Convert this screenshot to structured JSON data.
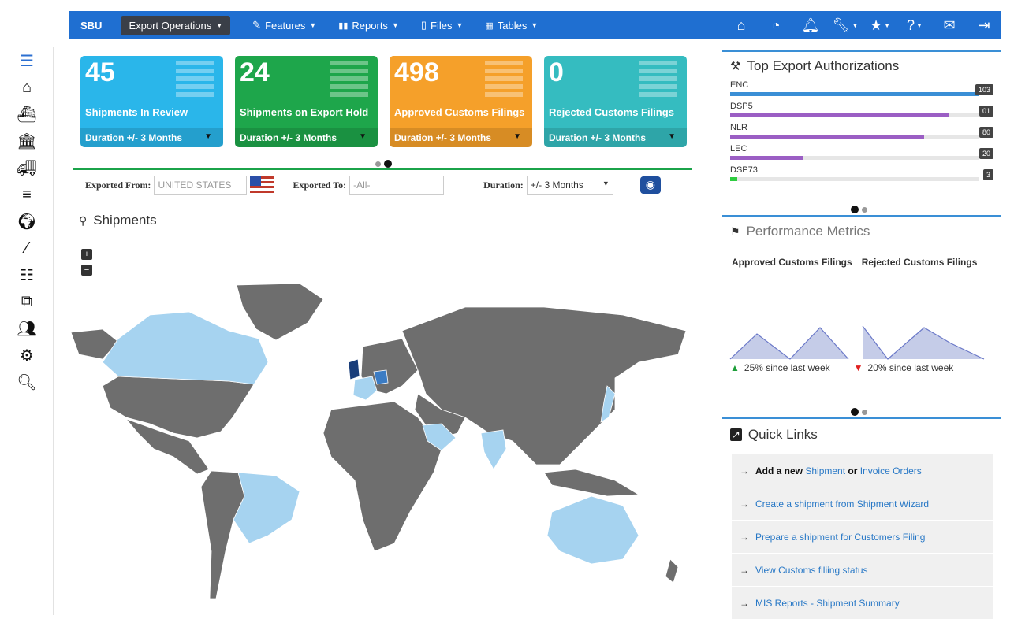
{
  "nav": {
    "brand": "SBU",
    "module": "Export Operations",
    "menus": [
      {
        "label": "Features",
        "icon": "pencil-icon"
      },
      {
        "label": "Reports",
        "icon": "bar-chart-icon"
      },
      {
        "label": "Files",
        "icon": "file-icon"
      },
      {
        "label": "Tables",
        "icon": "table-icon"
      }
    ],
    "icons": [
      "home-icon",
      "dashboard-icon",
      "bell-icon",
      "wrench-icon",
      "star-icon",
      "help-icon",
      "envelope-icon",
      "sign-out-icon"
    ]
  },
  "sidebar": [
    "list-lines-icon",
    "home-icon",
    "ship-icon",
    "bank-icon",
    "truck-icon",
    "menu-icon",
    "globe-icon",
    "magic-wand-icon",
    "ordered-list-icon",
    "external-link-icon",
    "users-icon",
    "cogs-icon",
    "search-icon"
  ],
  "cards": [
    {
      "value": "45",
      "label": "Shipments In Review",
      "footer": "Duration +/- 3 Months",
      "color": "#2ab6ea"
    },
    {
      "value": "24",
      "label": "Shipments on Export Hold",
      "footer": "Duration +/- 3 Months",
      "color": "#1ea64b"
    },
    {
      "value": "498",
      "label": "Approved Customs Filings",
      "footer": "Duration +/- 3 Months",
      "color": "#f5a02a"
    },
    {
      "value": "0",
      "label": "Rejected Customs Filings",
      "footer": "Duration +/- 3 Months",
      "color": "#35bcc0"
    }
  ],
  "filters": {
    "from_label": "Exported From:",
    "from_value": "UNITED STATES",
    "to_label": "Exported To:",
    "to_placeholder": "-All-",
    "duration_label": "Duration:",
    "duration_value": "+/- 3 Months"
  },
  "map": {
    "title": "Shipments",
    "zoom_in": "+",
    "zoom_out": "−"
  },
  "authorizations": {
    "title": "Top Export Authorizations",
    "items": [
      {
        "name": "ENC",
        "count": "103",
        "percent": 100,
        "color": "#3a8fd6"
      },
      {
        "name": "DSP5",
        "count": "01",
        "percent": 88,
        "color": "#9b5ec4"
      },
      {
        "name": "NLR",
        "count": "80",
        "percent": 78,
        "color": "#9b5ec4"
      },
      {
        "name": "LEC",
        "count": "20",
        "percent": 29,
        "color": "#9b5ec4"
      },
      {
        "name": "DSP73",
        "count": "3",
        "percent": 3,
        "color": "#2ecc40"
      }
    ]
  },
  "performance": {
    "title": "Performance Metrics",
    "approved_label": "Approved Customs Filings",
    "rejected_label": "Rejected Customs Filings",
    "approved_change": "25% since last week",
    "rejected_change": "20% since last week",
    "up_color": "#1e9e3a",
    "down_color": "#e02020"
  },
  "quick_links": {
    "title": "Quick Links",
    "add_prefix": "Add a new",
    "add_shipment": "Shipment",
    "add_or": "or",
    "add_invoice": "Invoice Orders",
    "items": [
      "Create a shipment from Shipment Wizard",
      "Prepare a shipment for Customers Filing",
      "View Customs filiing status",
      "MIS Reports - Shipment Summary"
    ]
  }
}
